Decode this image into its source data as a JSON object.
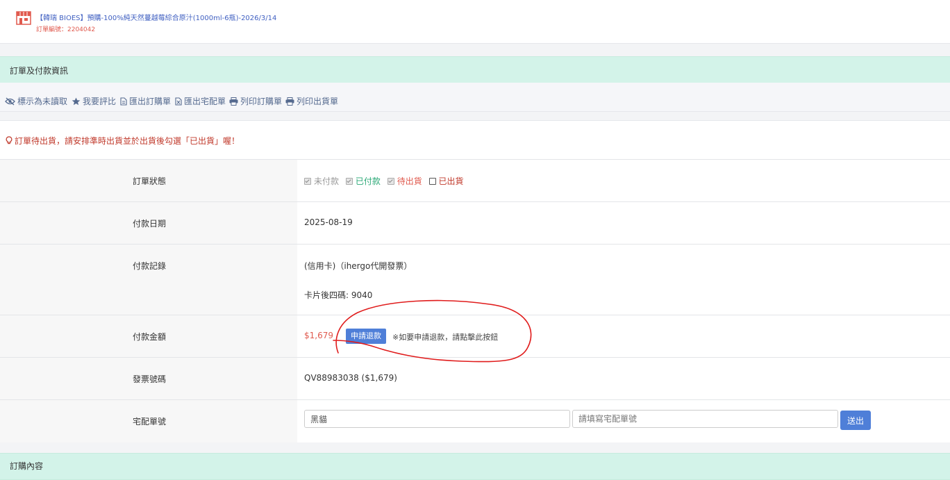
{
  "product": {
    "title": "【韓瑞 BIOES】預購-100%純天然蔓越莓綜合原汁(1000ml-6瓶)-2026/3/14",
    "order_no": "訂單編號：2204042"
  },
  "sections": {
    "order_payment": "訂單及付款資訊",
    "purchase_content": "訂購內容"
  },
  "toolbar": {
    "mark_unread": "標示為未讀取",
    "review": "我要評比",
    "export_order": "匯出訂購單",
    "export_delivery": "匯出宅配單",
    "print_order": "列印訂購單",
    "print_shipping": "列印出貨單"
  },
  "notice": "訂單待出貨，請安排準時出貨並於出貨後勾選「已出貨」喔！",
  "rows": {
    "status": {
      "label": "訂單狀態",
      "unpaid": "未付款",
      "paid": "已付款",
      "pending": "待出貨",
      "shipped": "已出貨"
    },
    "pay_date": {
      "label": "付款日期",
      "value": "2025-08-19"
    },
    "pay_record": {
      "label": "付款記錄",
      "method": "(信用卡)（ihergo代開發票）",
      "card": "卡片後四碼: 9040"
    },
    "amount": {
      "label": "付款金額",
      "value": "$1,679",
      "refund_button": "申請退款",
      "refund_note": "※如要申請退款，請點擊此按鈕"
    },
    "invoice": {
      "label": "發票號碼",
      "value": "QV88983038  ($1,679)"
    },
    "delivery": {
      "label": "宅配單號",
      "carrier": "黑貓",
      "tracking_placeholder": "請填寫宅配單號",
      "submit": "送出"
    }
  },
  "colors": {
    "accent": "#4f7fd8",
    "header_bg": "#d3f3e9",
    "alert": "#c0392b",
    "paid": "#2aa876",
    "pending": "#e05a4e"
  }
}
